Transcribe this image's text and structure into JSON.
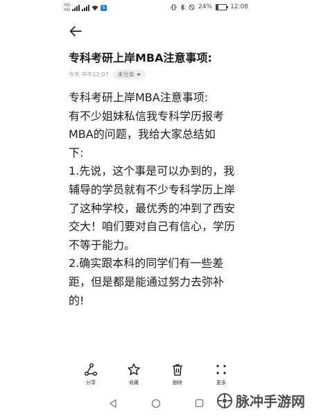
{
  "status_bar": {
    "sim1": "HD",
    "sim2": "HD",
    "battery": "24%",
    "battery_level": 0.24,
    "time": "12:08"
  },
  "note": {
    "title": "专科考研上岸MBA注意事项:",
    "timestamp": "今天 中午12:07",
    "category": "未分类",
    "body_lines": [
      "专科考研上岸MBA注意事项:",
      "有不少姐妹私信我专科学历报考",
      "MBA的问题，我给大家总结如",
      "下:",
      "1.先说，这个事是可以办到的，我",
      "辅导的学员就有不少专科学历上岸",
      "了这种学校，最优秀的冲到了西安",
      "交大！咱们要对自己有信心，学历",
      "不等于能力。",
      "2.确实跟本科的同学们有一些差",
      "距，但是都是能通过努力去弥补",
      "的!"
    ]
  },
  "toolbar": {
    "share": "分享",
    "favorite": "收藏",
    "delete": "删除",
    "more": "更多"
  },
  "watermark": {
    "text": "脉冲手游网"
  },
  "icons": {
    "back": "arrow-left-icon",
    "share": "share-icon",
    "favorite": "star-icon",
    "delete": "trash-icon",
    "more": "more-dots-icon",
    "nav_back": "triangle-back-icon",
    "nav_home": "circle-home-icon",
    "nav_recent": "square-recent-icon"
  }
}
